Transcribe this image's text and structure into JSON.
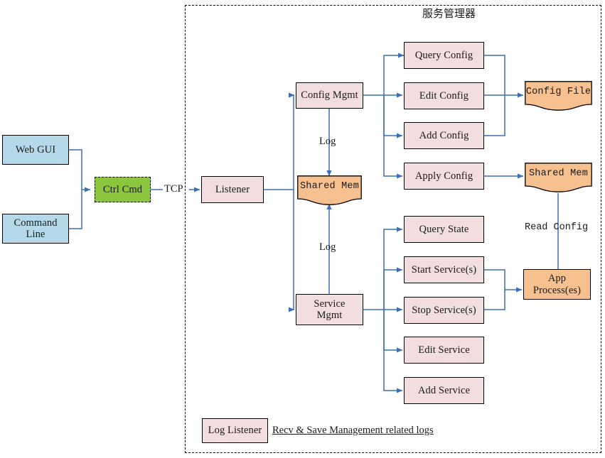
{
  "diagram": {
    "boundary_title": "服务管理器",
    "edge_color": "#3d6fb4",
    "colors": {
      "pink": "#f2dede",
      "blue": "#b5d9e8",
      "green": "#8cc63e",
      "peach": "#f7c08f",
      "border": "#000000",
      "edge": "#3d6fb4"
    },
    "clients": [
      {
        "id": "web-gui",
        "label": "Web GUI"
      },
      {
        "id": "command-line",
        "label": "Command\nLine"
      }
    ],
    "ctrl_cmd": {
      "label": "Ctrl Cmd"
    },
    "listener": {
      "label": "Listener"
    },
    "managers": [
      {
        "id": "config-mgmt",
        "label": "Config Mgmt"
      },
      {
        "id": "service-mgmt",
        "label": "Service\nMgmt"
      }
    ],
    "config_actions": [
      {
        "id": "query-config",
        "label": "Query Config"
      },
      {
        "id": "edit-config",
        "label": "Edit Config"
      },
      {
        "id": "add-config",
        "label": "Add Config"
      },
      {
        "id": "apply-config",
        "label": "Apply Config"
      }
    ],
    "service_actions": [
      {
        "id": "query-state",
        "label": "Query State"
      },
      {
        "id": "start-service",
        "label": "Start Service(s)"
      },
      {
        "id": "stop-service",
        "label": "Stop Service(s)"
      },
      {
        "id": "edit-service",
        "label": "Edit Service"
      },
      {
        "id": "add-service",
        "label": "Add Service"
      }
    ],
    "stores": [
      {
        "id": "shared-mem-center",
        "label": "Shared Mem"
      },
      {
        "id": "config-file",
        "label": "Config File"
      },
      {
        "id": "shared-mem-right",
        "label": "Shared Mem"
      }
    ],
    "app_process": {
      "label": "App\nProcess(es)"
    },
    "log_listener": {
      "label": "Log Listener",
      "note": "Recv & Save Management related logs"
    },
    "edge_labels": {
      "tcp": "TCP",
      "log_config": "Log",
      "log_service": "Log",
      "read_config": "Read Config"
    }
  }
}
